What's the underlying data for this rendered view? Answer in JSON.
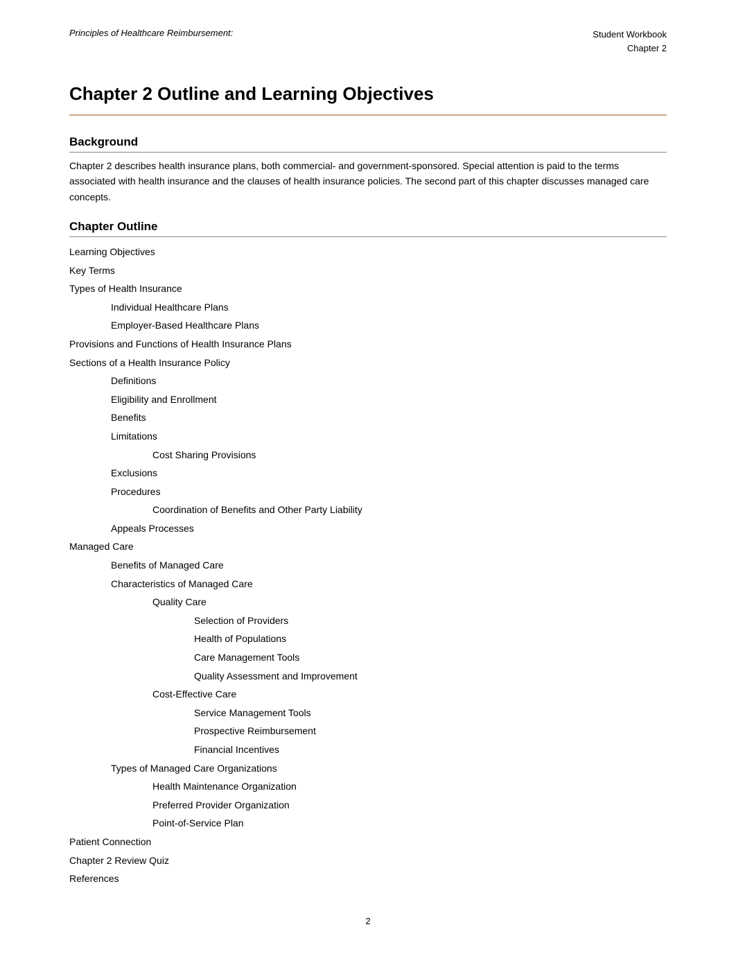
{
  "header": {
    "left": "Principles of Healthcare Reimbursement:",
    "right_line1": "Student Workbook",
    "right_line2": "Chapter 2"
  },
  "chapter_title": "Chapter 2 Outline and Learning Objectives",
  "background": {
    "heading": "Background",
    "text": "Chapter 2 describes health insurance plans, both commercial- and government-sponsored. Special attention is paid to the terms associated with health insurance and the clauses of health insurance policies. The second part of this chapter discusses managed care concepts."
  },
  "outline": {
    "heading": "Chapter Outline",
    "items": [
      {
        "level": 0,
        "text": "Learning Objectives"
      },
      {
        "level": 0,
        "text": "Key Terms"
      },
      {
        "level": 0,
        "text": "Types of Health Insurance"
      },
      {
        "level": 1,
        "text": "Individual Healthcare Plans"
      },
      {
        "level": 1,
        "text": "Employer-Based Healthcare Plans"
      },
      {
        "level": 0,
        "text": "Provisions and Functions of Health Insurance Plans"
      },
      {
        "level": 0,
        "text": "Sections of a Health Insurance Policy"
      },
      {
        "level": 1,
        "text": "Definitions"
      },
      {
        "level": 1,
        "text": "Eligibility and Enrollment"
      },
      {
        "level": 1,
        "text": "Benefits"
      },
      {
        "level": 1,
        "text": "Limitations"
      },
      {
        "level": 2,
        "text": "Cost Sharing Provisions"
      },
      {
        "level": 1,
        "text": "Exclusions"
      },
      {
        "level": 1,
        "text": "Procedures"
      },
      {
        "level": 2,
        "text": "Coordination of Benefits and Other Party Liability"
      },
      {
        "level": 1,
        "text": "Appeals Processes"
      },
      {
        "level": 0,
        "text": "Managed Care"
      },
      {
        "level": 1,
        "text": "Benefits of Managed Care"
      },
      {
        "level": 1,
        "text": "Characteristics of Managed Care"
      },
      {
        "level": 2,
        "text": "Quality Care"
      },
      {
        "level": 3,
        "text": "Selection of Providers"
      },
      {
        "level": 3,
        "text": "Health of Populations"
      },
      {
        "level": 3,
        "text": "Care Management Tools"
      },
      {
        "level": 3,
        "text": "Quality Assessment and Improvement"
      },
      {
        "level": 2,
        "text": "Cost-Effective Care"
      },
      {
        "level": 3,
        "text": "Service Management Tools"
      },
      {
        "level": 3,
        "text": "Prospective Reimbursement"
      },
      {
        "level": 3,
        "text": "Financial Incentives"
      },
      {
        "level": 1,
        "text": "Types of Managed Care Organizations"
      },
      {
        "level": 2,
        "text": "Health Maintenance Organization"
      },
      {
        "level": 2,
        "text": "Preferred Provider Organization"
      },
      {
        "level": 2,
        "text": "Point-of-Service Plan"
      },
      {
        "level": 0,
        "text": "Patient Connection"
      },
      {
        "level": 0,
        "text": "Chapter 2 Review Quiz"
      },
      {
        "level": 0,
        "text": "References"
      }
    ]
  },
  "footer": {
    "page_number": "2"
  }
}
